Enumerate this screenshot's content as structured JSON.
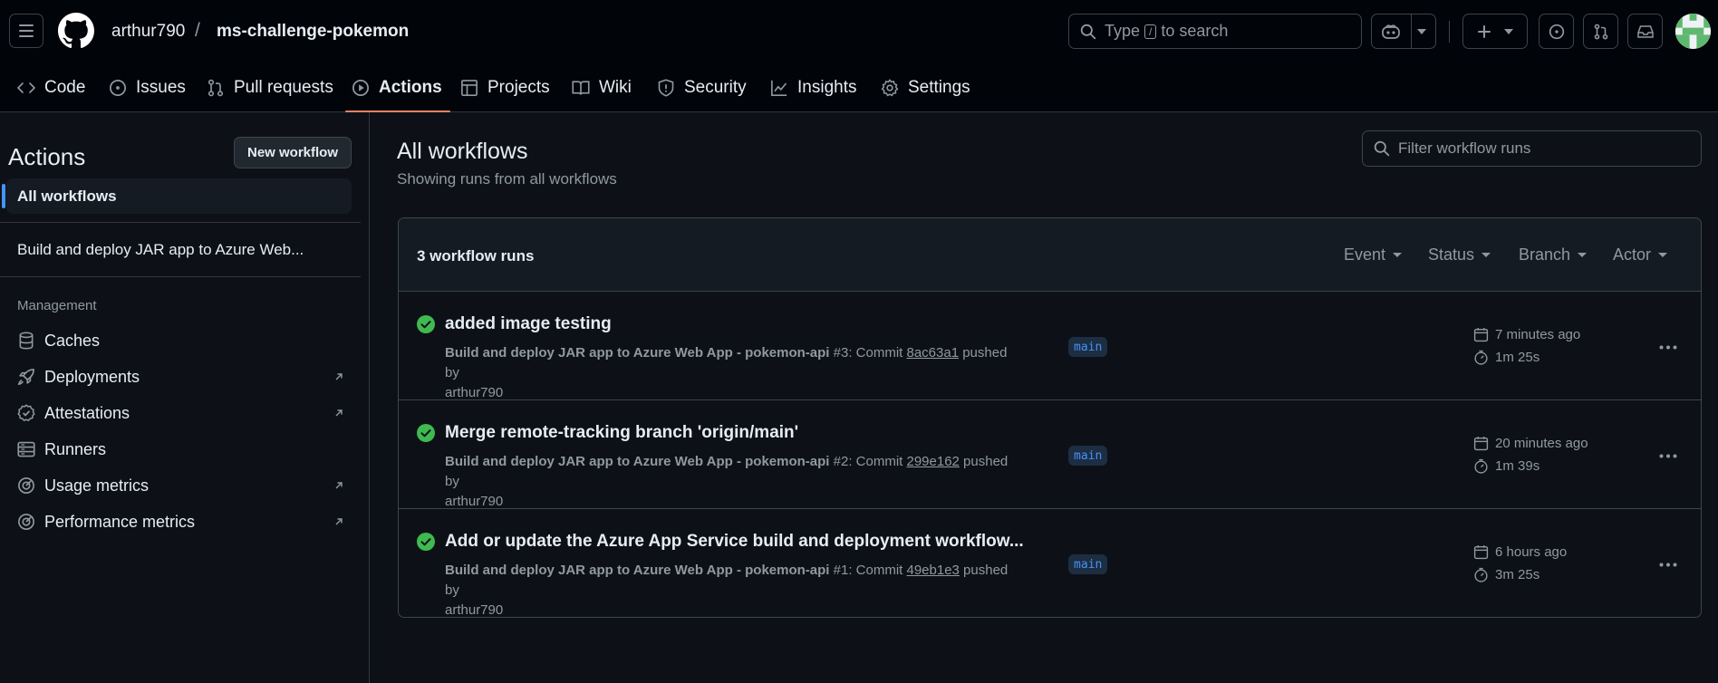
{
  "header": {
    "owner": "arthur790",
    "separator": "/",
    "repo": "ms-challenge-pokemon",
    "search_prefix": "Type",
    "search_key": "/",
    "search_suffix": "to search"
  },
  "repo_tabs": [
    {
      "label": "Code",
      "icon": "code-icon"
    },
    {
      "label": "Issues",
      "icon": "issue-icon"
    },
    {
      "label": "Pull requests",
      "icon": "pull-request-icon"
    },
    {
      "label": "Actions",
      "icon": "play-icon",
      "active": true
    },
    {
      "label": "Projects",
      "icon": "table-icon"
    },
    {
      "label": "Wiki",
      "icon": "book-icon"
    },
    {
      "label": "Security",
      "icon": "shield-icon"
    },
    {
      "label": "Insights",
      "icon": "graph-icon"
    },
    {
      "label": "Settings",
      "icon": "gear-icon"
    }
  ],
  "sidebar": {
    "title": "Actions",
    "new_workflow": "New workflow",
    "all_workflows": "All workflows",
    "workflow": "Build and deploy JAR app to Azure Web...",
    "management_heading": "Management",
    "items": [
      {
        "label": "Caches",
        "icon": "database-icon",
        "external": false
      },
      {
        "label": "Deployments",
        "icon": "rocket-icon",
        "external": true
      },
      {
        "label": "Attestations",
        "icon": "verified-icon",
        "external": true
      },
      {
        "label": "Runners",
        "icon": "server-icon",
        "external": false
      },
      {
        "label": "Usage metrics",
        "icon": "meter-icon",
        "external": true
      },
      {
        "label": "Performance metrics",
        "icon": "meter-icon",
        "external": true
      }
    ]
  },
  "main": {
    "title": "All workflows",
    "subtitle": "Showing runs from all workflows",
    "filter_placeholder": "Filter workflow runs",
    "runs_count": "3 workflow runs",
    "filters": [
      "Event",
      "Status",
      "Branch",
      "Actor"
    ],
    "runs": [
      {
        "title": "added image testing",
        "workflow": "Build and deploy JAR app to Azure Web App - pokemon-api",
        "run_number": "#3",
        "commit_prefix": ": Commit ",
        "sha": "8ac63a1",
        "pushed_by": " pushed by",
        "actor": "arthur790",
        "branch": "main",
        "when": "7 minutes ago",
        "duration": "1m 25s",
        "status": "success"
      },
      {
        "title": "Merge remote-tracking branch 'origin/main'",
        "workflow": "Build and deploy JAR app to Azure Web App - pokemon-api",
        "run_number": "#2",
        "commit_prefix": ": Commit ",
        "sha": "299e162",
        "pushed_by": " pushed by",
        "actor": "arthur790",
        "branch": "main",
        "when": "20 minutes ago",
        "duration": "1m 39s",
        "status": "success"
      },
      {
        "title": "Add or update the Azure App Service build and deployment workflow...",
        "workflow": "Build and deploy JAR app to Azure Web App - pokemon-api",
        "run_number": "#1",
        "commit_prefix": ": Commit ",
        "sha": "49eb1e3",
        "pushed_by": " pushed by",
        "actor": "arthur790",
        "branch": "main",
        "when": "6 hours ago",
        "duration": "3m 25s",
        "status": "success"
      }
    ]
  },
  "colors": {
    "success": "#3fb950",
    "accent_underline": "#f78166",
    "link_blue": "#4493f8"
  }
}
